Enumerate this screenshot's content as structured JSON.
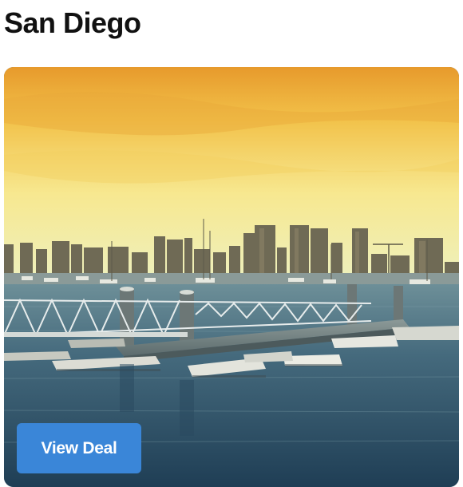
{
  "destination": {
    "title": "San Diego"
  },
  "card": {
    "button_label": "View Deal",
    "image_icon": "san-diego-harbor-photo"
  },
  "colors": {
    "button_bg": "#3a86d8",
    "button_text": "#ffffff",
    "title_text": "#111111"
  }
}
